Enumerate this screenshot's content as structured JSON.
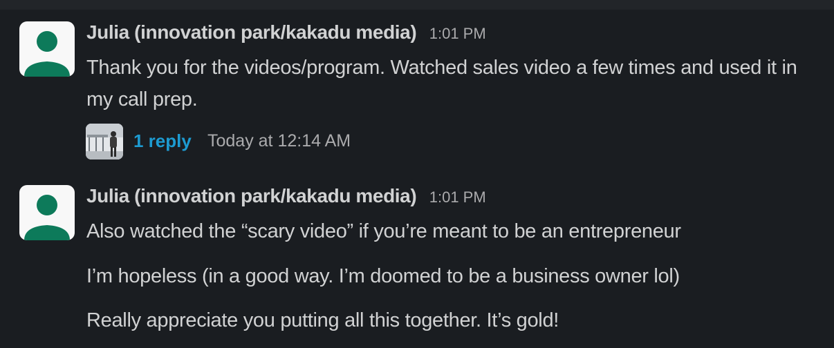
{
  "messages": [
    {
      "sender": "Julia (innovation park/kakadu media)",
      "time": "1:01 PM",
      "avatar_icon": "default-user-icon",
      "text": "Thank you for the videos/program. Watched sales video a few times and used it in my call prep.",
      "thread": {
        "reply_count": "1 reply",
        "last_reply": "Today at 12:14 AM"
      }
    },
    {
      "sender": "Julia (innovation park/kakadu media)",
      "time": "1:01 PM",
      "avatar_icon": "default-user-icon",
      "paragraphs": [
        "Also watched the “scary video” if you’re meant to be an entrepreneur",
        "I’m hopeless (in a good way. I’m doomed to be a business owner lol)",
        "Really appreciate you putting all this together. It’s gold!"
      ]
    }
  ],
  "colors": {
    "background": "#1a1d21",
    "avatar_green": "#0d7a5a",
    "link_blue": "#1d9bd1"
  }
}
